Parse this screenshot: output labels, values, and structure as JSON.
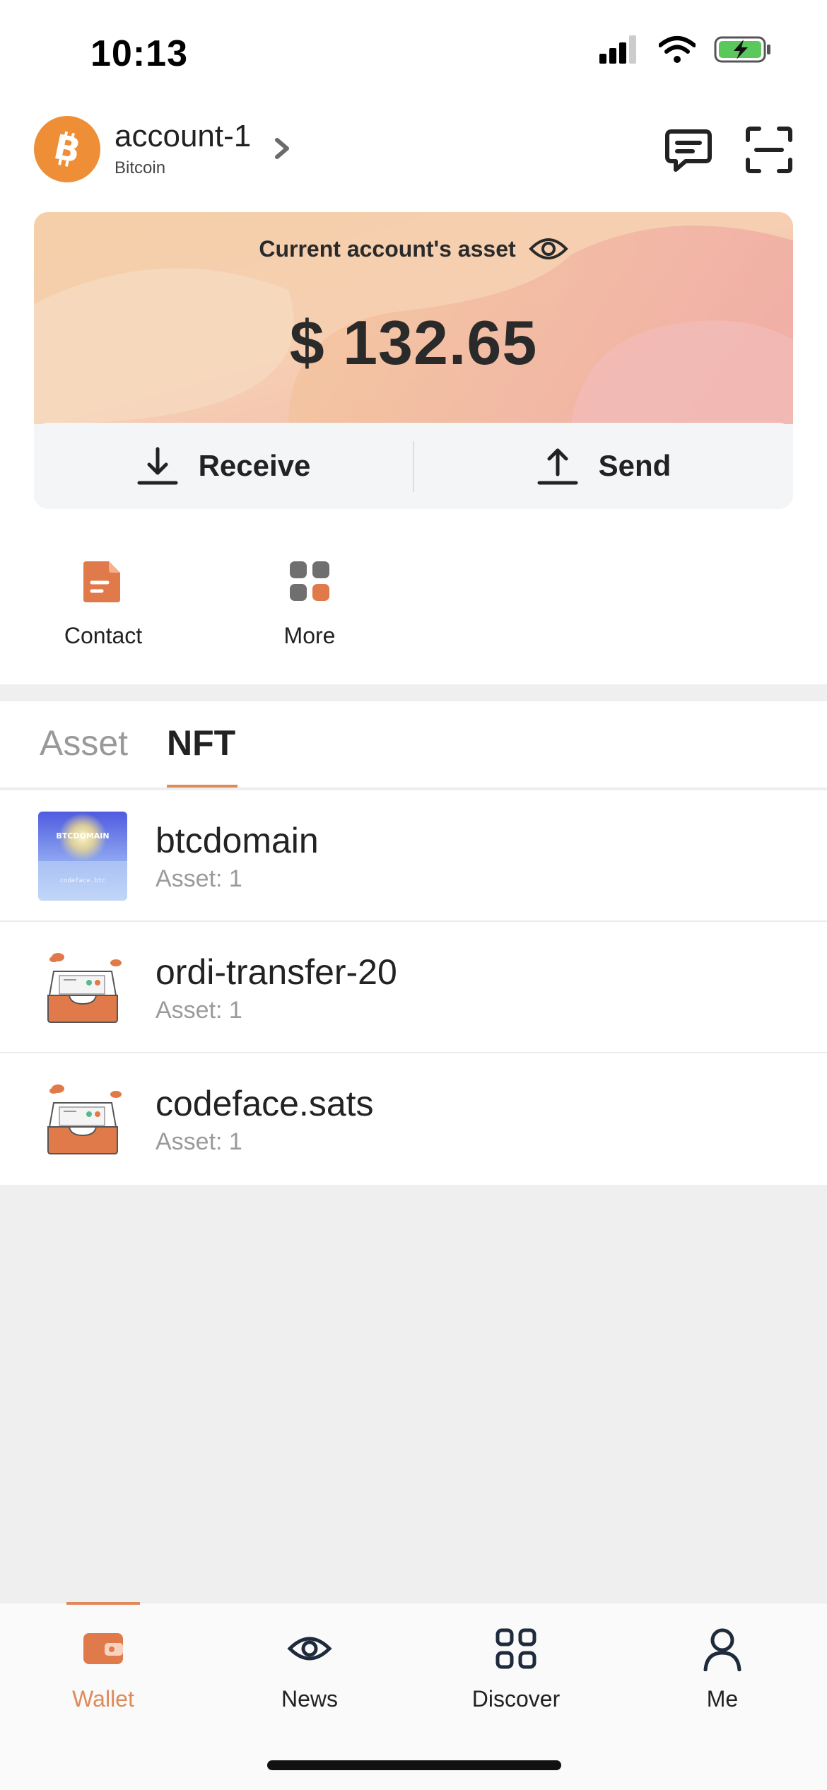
{
  "status_bar": {
    "time": "10:13"
  },
  "header": {
    "account_name": "account-1",
    "chain_name": "Bitcoin",
    "icons": [
      "bitcoin-icon",
      "chevron-right-icon",
      "chat-icon",
      "scan-icon"
    ]
  },
  "asset_card": {
    "label": "Current account's asset",
    "amount": "$ 132.65",
    "receive_label": "Receive",
    "send_label": "Send"
  },
  "shortcuts": [
    {
      "label": "Contact",
      "icon": "contact-document-icon"
    },
    {
      "label": "More",
      "icon": "grid-more-icon"
    }
  ],
  "tabs": [
    {
      "label": "Asset",
      "active": false
    },
    {
      "label": "NFT",
      "active": true
    }
  ],
  "nft_items": [
    {
      "name": "btcdomain",
      "sub": "Asset: 1",
      "thumb_title": "BTCDOMAIN",
      "thumb_caption": "codeface.btc"
    },
    {
      "name": "ordi-transfer-20",
      "sub": "Asset: 1"
    },
    {
      "name": "codeface.sats",
      "sub": "Asset: 1"
    }
  ],
  "bottom_nav": [
    {
      "label": "Wallet",
      "icon": "wallet-icon",
      "active": true
    },
    {
      "label": "News",
      "icon": "eye-icon",
      "active": false
    },
    {
      "label": "Discover",
      "icon": "discover-grid-icon",
      "active": false
    },
    {
      "label": "Me",
      "icon": "person-icon",
      "active": false
    }
  ],
  "colors": {
    "accent": "#e08a5a",
    "bitcoin": "#ee8e37",
    "battery": "#5ac85a"
  }
}
